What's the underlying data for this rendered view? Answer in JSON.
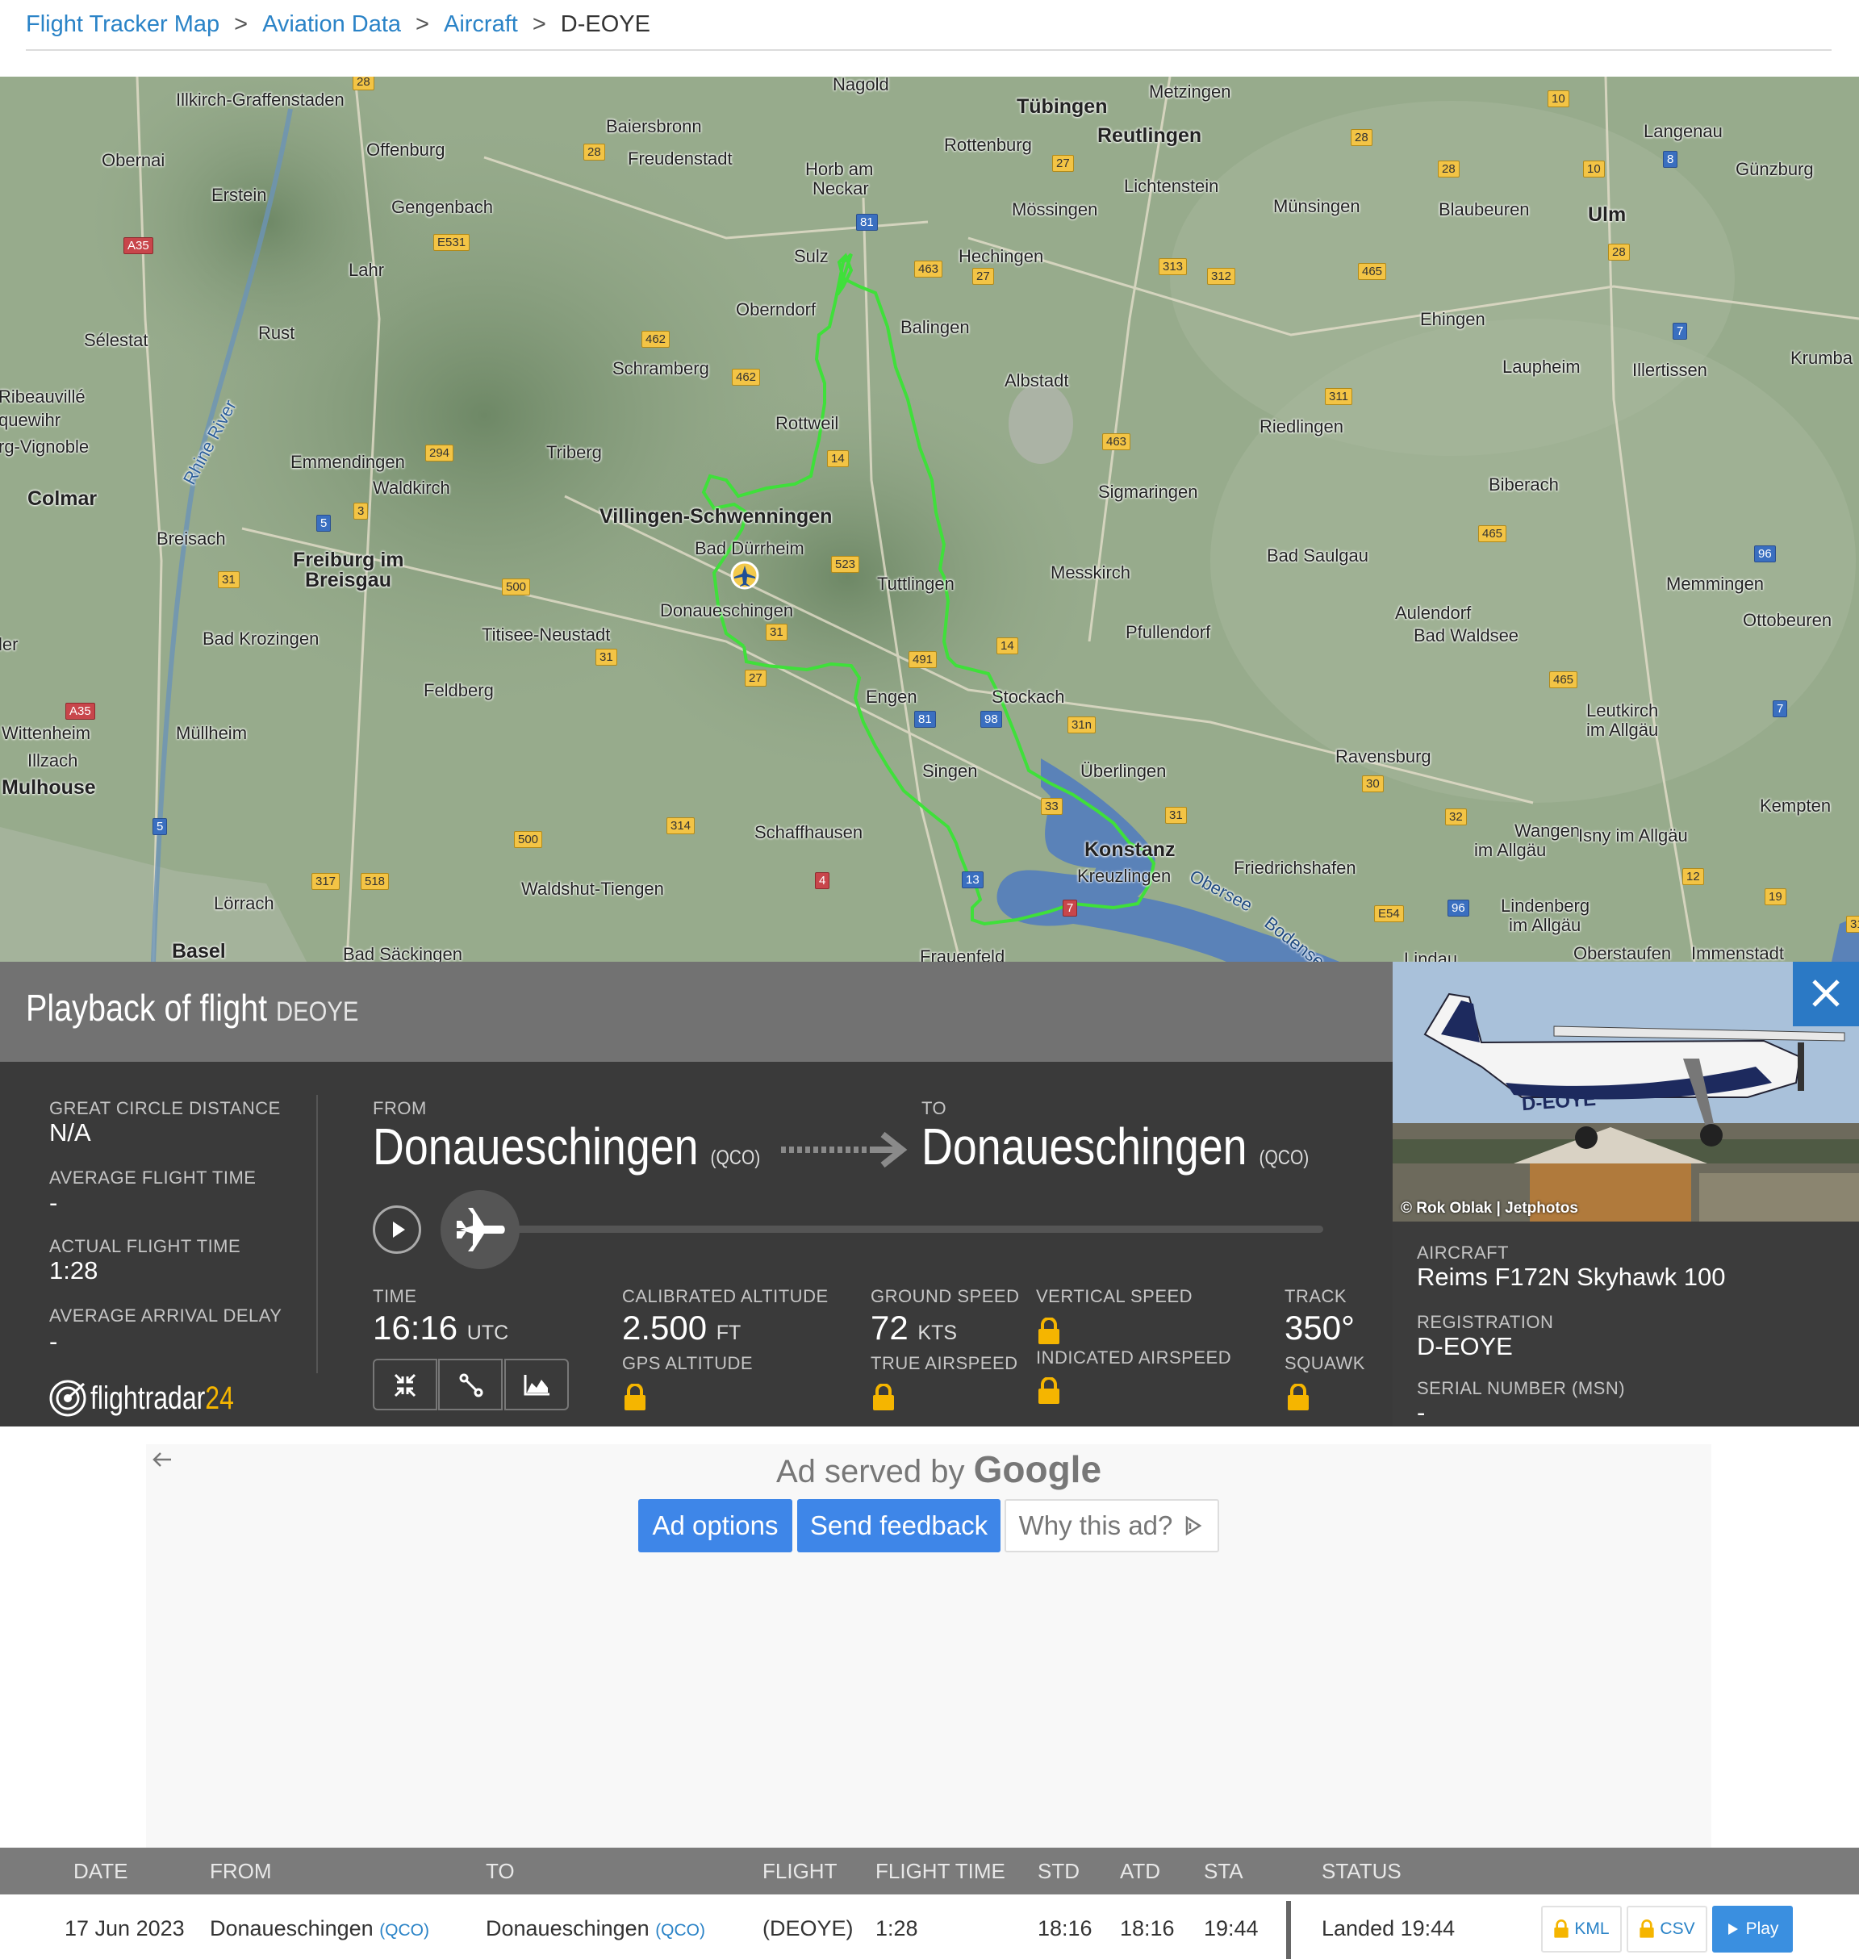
{
  "breadcrumb": {
    "items": [
      "Flight Tracker Map",
      "Aviation Data",
      "Aircraft"
    ],
    "separator": ">",
    "current": "D-EOYE"
  },
  "map": {
    "towns": [
      "Illkirch-Graffenstaden",
      "Obernai",
      "Erstein",
      "Sélestat",
      "Ribeauvillé",
      "quewihr",
      "rg-Vignoble",
      "Colmar",
      "Breisach",
      "Wittenheim",
      "Illzach",
      "Mulhouse",
      "Müllheim",
      "Lörrach",
      "Basel",
      "Bad Säckingen",
      "Offenburg",
      "Gengenbach",
      "Lahr",
      "Rust",
      "Emmendingen",
      "Waldkirch",
      "Freiburg im",
      "Breisgau",
      "Bad Krozingen",
      "Baiersbronn",
      "Freudenstadt",
      "Triberg",
      "Titisee-Neustadt",
      "Feldberg",
      "Waldshut-Tiengen",
      "Schaffhausen",
      "Nagold",
      "Horb am",
      "Neckar",
      "Sulz",
      "Oberndorf",
      "Schramberg",
      "Rottweil",
      "Villingen-Schwenningen",
      "Bad Dürrheim",
      "Donaueschingen",
      "Tuttlingen",
      "Engen",
      "Singen",
      "Stockach",
      "Überlingen",
      "Konstanz",
      "Kreuzlingen",
      "Frauenfeld",
      "Tübingen",
      "Reutlingen",
      "Rottenburg",
      "Metzingen",
      "Lichtenstein",
      "Mössingen",
      "Hechingen",
      "Balingen",
      "Albstadt",
      "Sigmaringen",
      "Messkirch",
      "Pfullendorf",
      "Münsingen",
      "Riedlingen",
      "Bad Saulgau",
      "Aulendorf",
      "Bad Waldsee",
      "Ravensburg",
      "Friedrichshafen",
      "Biberach",
      "Ehingen",
      "Laupheim",
      "Blaubeuren",
      "Ulm",
      "Langenau",
      "Günzburg",
      "Illertissen",
      "Krumba",
      "Memmingen",
      "Ottobeuren",
      "Leutkirch",
      "im Allgäu",
      "Wangen",
      "im Allgäu",
      "Isny im Allgäu",
      "Kempten",
      "Lindenberg",
      "im Allgäu",
      "Lindau",
      "Oberstaufen",
      "Immenstadt",
      "ler",
      "Rhine River",
      "Obersee",
      "Bodense"
    ],
    "roads": [
      "28",
      "28",
      "A35",
      "E531",
      "294",
      "3",
      "5",
      "31",
      "A35",
      "5",
      "317",
      "518",
      "500",
      "31",
      "500",
      "462",
      "462",
      "14",
      "523",
      "31",
      "27",
      "314",
      "4",
      "81",
      "463",
      "27",
      "491",
      "81",
      "98",
      "14",
      "31n",
      "33",
      "13",
      "7",
      "31",
      "313",
      "312",
      "27",
      "463",
      "465",
      "311",
      "465",
      "96",
      "465",
      "30",
      "32",
      "12",
      "19",
      "E54",
      "96",
      "7",
      "10",
      "28",
      "28",
      "10",
      "8",
      "28",
      "7",
      "31"
    ]
  },
  "playback": {
    "title": "Playback of flight",
    "flight_code": "DEOYE",
    "stats": {
      "gcd_label": "GREAT CIRCLE DISTANCE",
      "gcd_value": "N/A",
      "aft_label": "AVERAGE FLIGHT TIME",
      "aft_value": "-",
      "act_label": "ACTUAL FLIGHT TIME",
      "act_value": "1:28",
      "aad_label": "AVERAGE ARRIVAL DELAY",
      "aad_value": "-"
    },
    "brand": "flightradar",
    "brand_num": "24",
    "from_label": "FROM",
    "from_city": "Donaueschingen",
    "from_code": "(QCO)",
    "to_label": "TO",
    "to_city": "Donaueschingen",
    "to_code": "(QCO)",
    "progress": 0.0,
    "time_label": "TIME",
    "time_value": "16:16",
    "time_unit": "UTC",
    "alt_label": "CALIBRATED ALTITUDE",
    "alt_value": "2.500",
    "alt_unit": "FT",
    "gps_label": "GPS ALTITUDE",
    "gs_label": "GROUND SPEED",
    "gs_value": "72",
    "gs_unit": "KTS",
    "tas_label": "TRUE AIRSPEED",
    "vs_label": "VERTICAL SPEED",
    "ias_label": "INDICATED AIRSPEED",
    "track_label": "TRACK",
    "track_value": "350°",
    "squawk_label": "SQUAWK",
    "lock_color": "#f5b500"
  },
  "aircraft": {
    "photo_credit": "© Rok Oblak | Jetphotos",
    "photo_reg": "D-EOYE",
    "aircraft_label": "AIRCRAFT",
    "aircraft_value": "Reims F172N Skyhawk 100",
    "reg_label": "REGISTRATION",
    "reg_value": "D-EOYE",
    "msn_label": "SERIAL NUMBER (MSN)",
    "msn_value": "-"
  },
  "ad": {
    "served_by": "Ad served by",
    "google": "Google",
    "options": "Ad options",
    "feedback": "Send feedback",
    "why": "Why this ad?"
  },
  "table": {
    "headers": [
      "DATE",
      "FROM",
      "TO",
      "FLIGHT",
      "FLIGHT TIME",
      "STD",
      "ATD",
      "STA",
      "STATUS"
    ],
    "row": {
      "date": "17 Jun 2023",
      "from": "Donaueschingen",
      "from_code": "(QCO)",
      "to": "Donaueschingen",
      "to_code": "(QCO)",
      "flight": "(DEOYE)",
      "flight_time": "1:28",
      "std": "18:16",
      "atd": "18:16",
      "sta": "19:44",
      "status": "Landed 19:44",
      "kml": "KML",
      "csv": "CSV",
      "play": "Play"
    }
  },
  "colors": {
    "link": "#2a83c7",
    "track": "#3fe03a",
    "accent": "#2b79c5"
  }
}
